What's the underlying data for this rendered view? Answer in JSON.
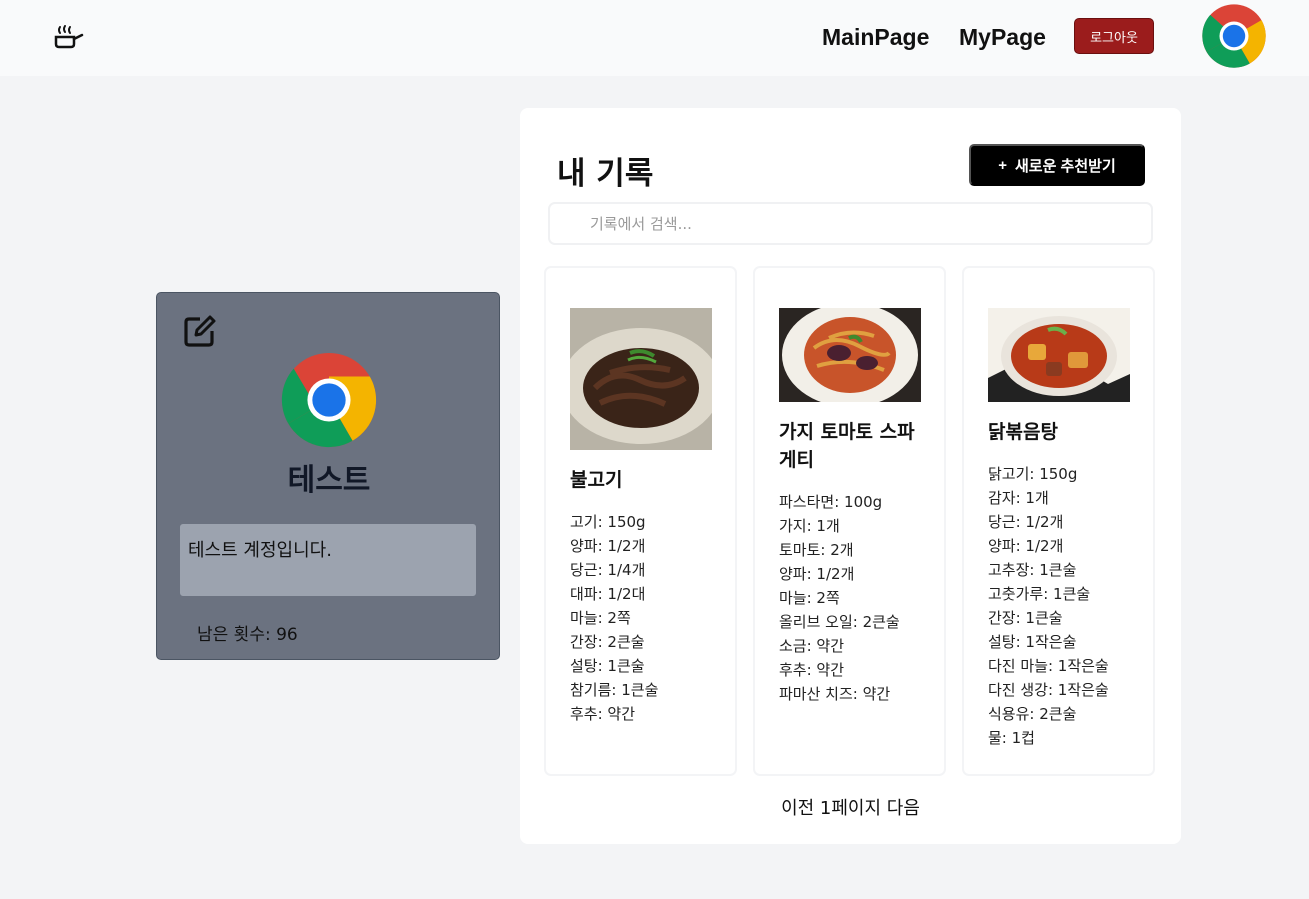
{
  "header": {
    "logo_icon": "frying-pan-icon",
    "nav": {
      "main": "MainPage",
      "my": "MyPage"
    },
    "logout_label": "로그아웃",
    "avatar_icon": "chrome-avatar-icon"
  },
  "profile": {
    "edit_icon": "edit-icon",
    "name": "테스트",
    "bio": "테스트 계정입니다.",
    "remaining": "남은 횟수: 96"
  },
  "records": {
    "title": "내 기록",
    "new_button": "새로운 추천받기",
    "search_placeholder": "기록에서 검색...",
    "cards": [
      {
        "title": "불고기",
        "ingredients": [
          "고기: 150g",
          "양파: 1/2개",
          "당근: 1/4개",
          "대파: 1/2대",
          "마늘: 2쪽",
          "간장: 2큰술",
          "설탕: 1큰술",
          "참기름: 1큰술",
          "후추: 약간"
        ]
      },
      {
        "title": "가지 토마토 스파게티",
        "ingredients": [
          "파스타면: 100g",
          "가지: 1개",
          "토마토: 2개",
          "양파: 1/2개",
          "마늘: 2쪽",
          "올리브 오일: 2큰술",
          "소금: 약간",
          "후추: 약간",
          "파마산 치즈: 약간"
        ]
      },
      {
        "title": "닭볶음탕",
        "ingredients": [
          "닭고기: 150g",
          "감자: 1개",
          "당근: 1/2개",
          "양파: 1/2개",
          "고추장: 1큰술",
          "고춧가루: 1큰술",
          "간장: 1큰술",
          "설탕: 1작은술",
          "다진 마늘: 1작은술",
          "다진 생강: 1작은술",
          "식용유: 2큰술",
          "물: 1컵"
        ]
      }
    ],
    "pagination": {
      "prev": "이전",
      "page": "1페이지",
      "next": "다음"
    }
  },
  "colors": {
    "logout": "#9b1c1c",
    "profile_bg": "#6b7280",
    "accent": "#000000"
  }
}
